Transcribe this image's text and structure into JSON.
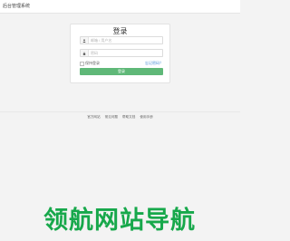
{
  "header": {
    "title": "后台管理系统"
  },
  "login": {
    "title": "登录",
    "username_placeholder": "邮箱 / 用户名",
    "password_placeholder": "密码",
    "remember_label": "保持登录",
    "forgot_label": "忘记密码？",
    "submit_label": "登录",
    "accent_color": "#5fb878"
  },
  "footer": {
    "links": [
      "官方网站",
      "常见问题",
      "帮助文档",
      "使用手册"
    ]
  },
  "watermark": {
    "text": "领航网站导航"
  }
}
